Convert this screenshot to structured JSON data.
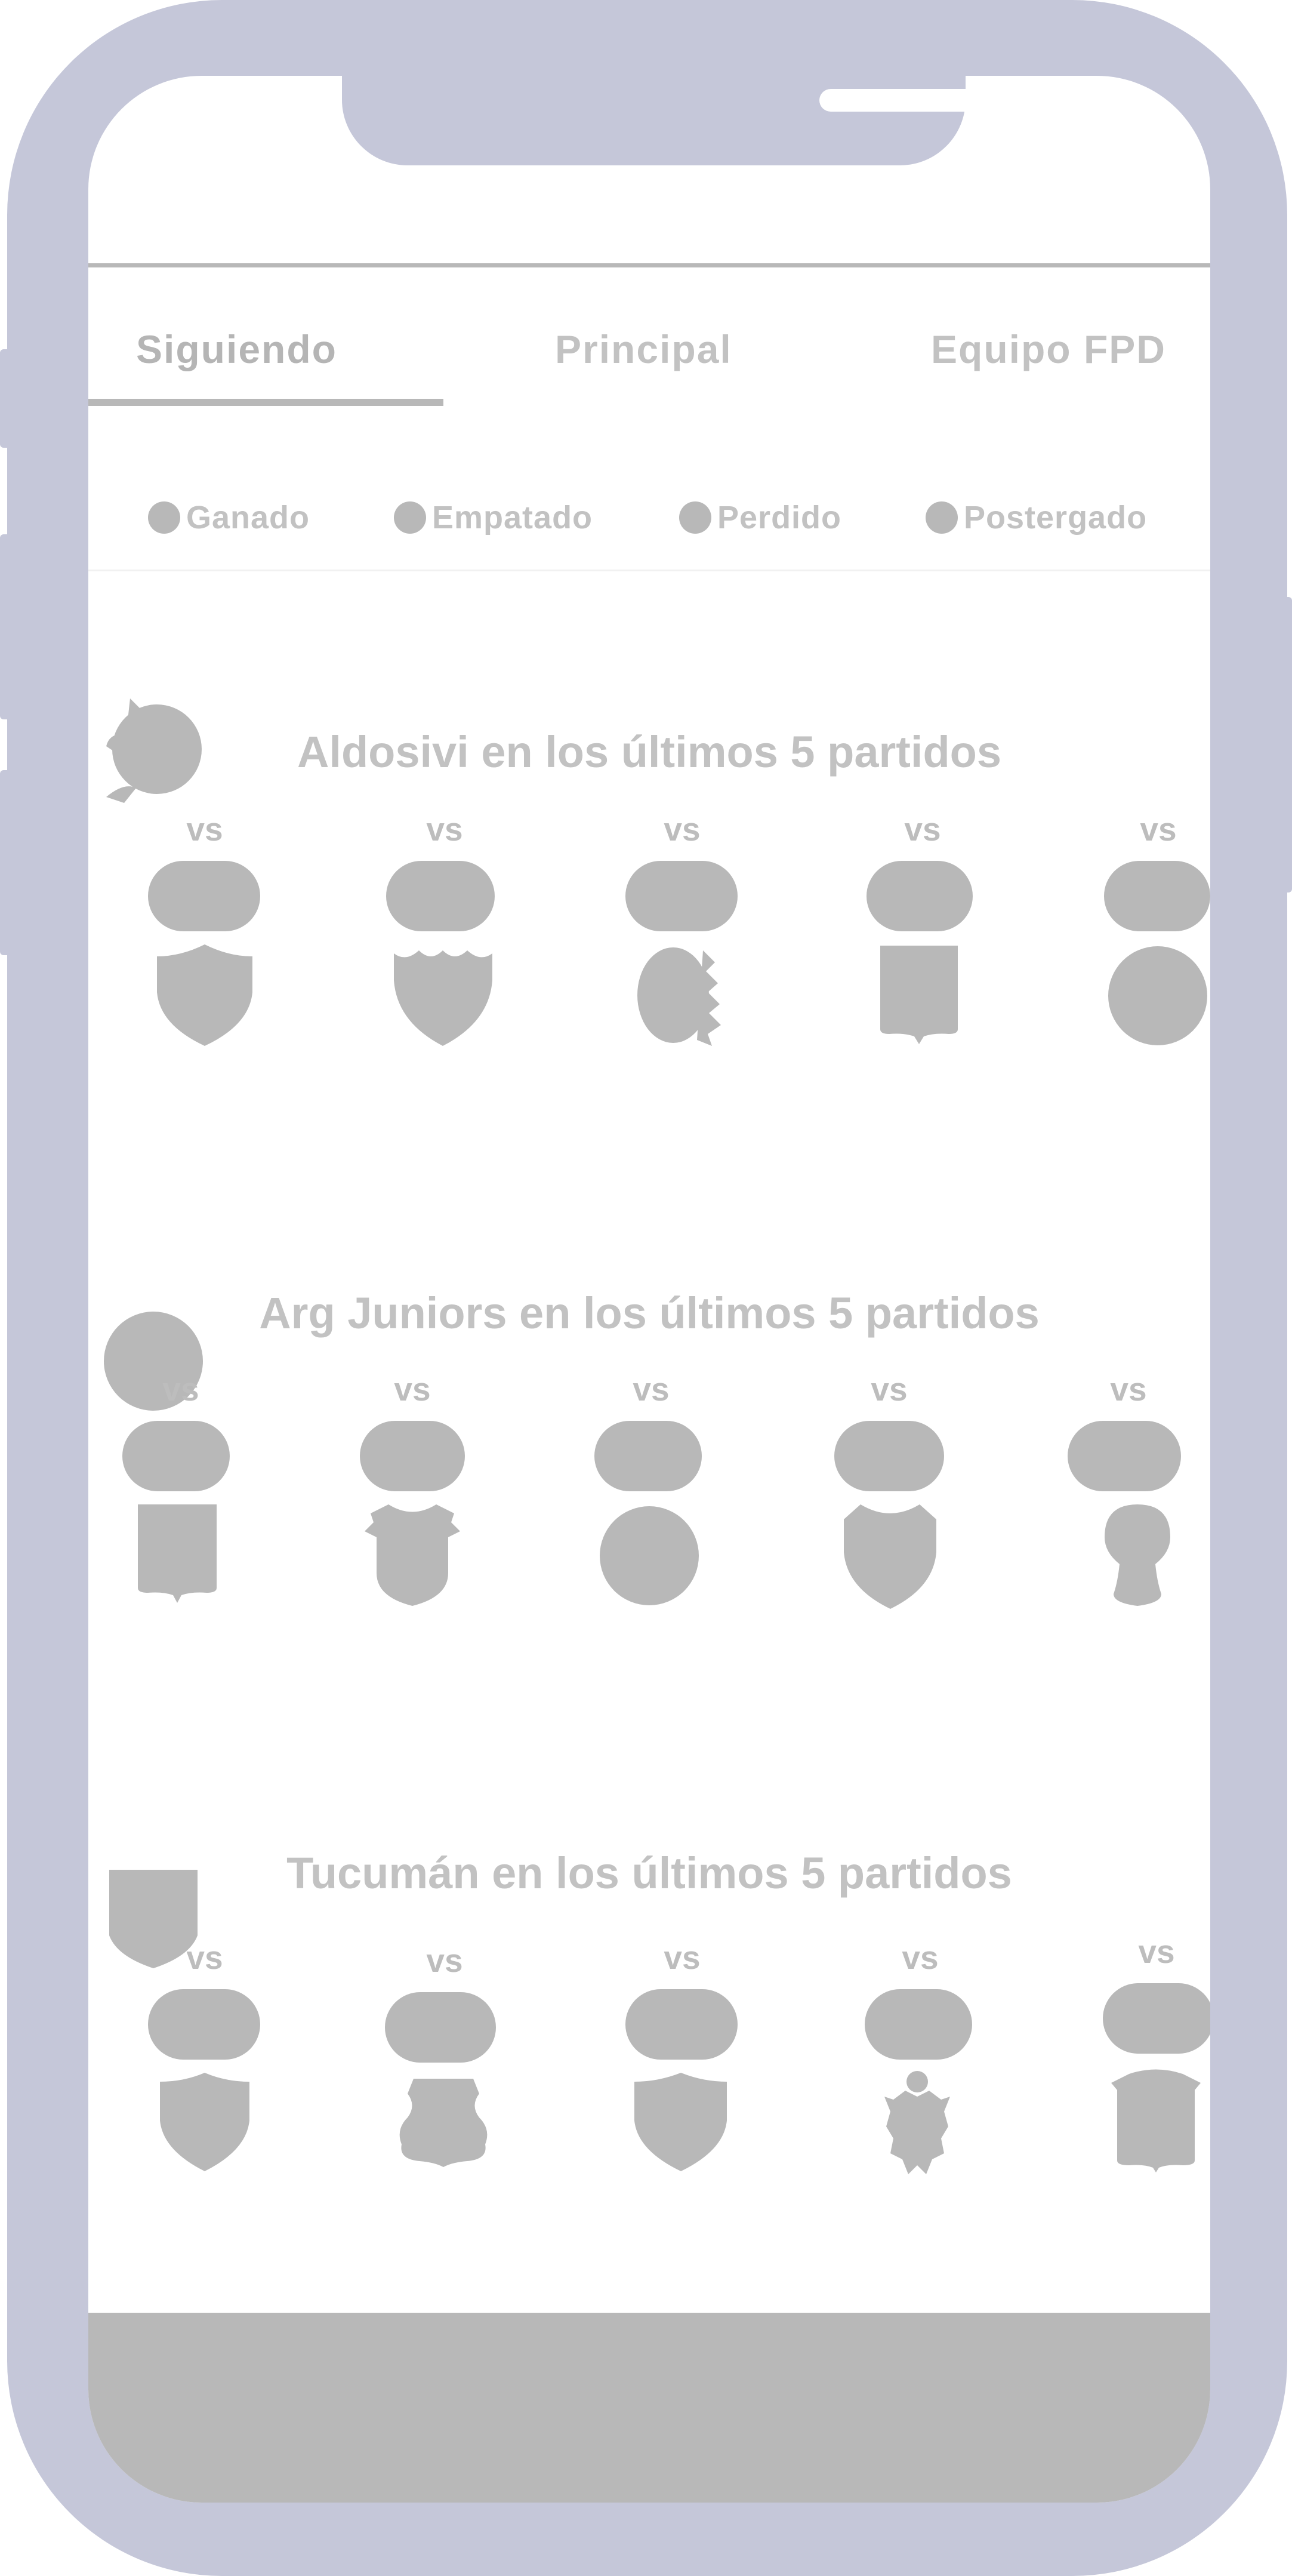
{
  "tabs": [
    {
      "label": "Siguiendo",
      "active": true
    },
    {
      "label": "Principal",
      "active": false
    },
    {
      "label": "Equipo FPD",
      "active": false
    }
  ],
  "legend": [
    {
      "label": "Ganado",
      "icon": "dot-icon"
    },
    {
      "label": "Empatado",
      "icon": "dot-icon"
    },
    {
      "label": "Perdido",
      "icon": "dot-icon"
    },
    {
      "label": "Postergado",
      "icon": "dot-icon"
    }
  ],
  "sections": [
    {
      "title": "Aldosivi en los últimos 5 partidos",
      "team_icon": "aldosivi-shark-icon",
      "matches": [
        {
          "vs": "vs",
          "crest_icon": "shield-notched-icon"
        },
        {
          "vs": "vs",
          "crest_icon": "shield-notched-icon"
        },
        {
          "vs": "vs",
          "crest_icon": "laurel-crest-icon"
        },
        {
          "vs": "vs",
          "crest_icon": "square-shield-icon"
        },
        {
          "vs": "vs",
          "crest_icon": "circle-crest-icon"
        }
      ]
    },
    {
      "title": "Arg Juniors en los últimos 5 partidos",
      "team_icon": "circle-crest-icon",
      "matches": [
        {
          "vs": "vs",
          "crest_icon": "square-shield-icon"
        },
        {
          "vs": "vs",
          "crest_icon": "crowned-crest-icon"
        },
        {
          "vs": "vs",
          "crest_icon": "circle-crest-icon"
        },
        {
          "vs": "vs",
          "crest_icon": "shield-notched-icon"
        },
        {
          "vs": "vs",
          "crest_icon": "bulb-crest-icon"
        }
      ]
    },
    {
      "title": "Tucumán en los últimos 5 partidos",
      "team_icon": "shield-icon",
      "matches": [
        {
          "vs": "vs",
          "crest_icon": "shield-notched-icon"
        },
        {
          "vs": "vs",
          "crest_icon": "badge-crest-icon"
        },
        {
          "vs": "vs",
          "crest_icon": "shield-notched-icon"
        },
        {
          "vs": "vs",
          "crest_icon": "eagle-crest-icon"
        },
        {
          "vs": "vs",
          "crest_icon": "flat-shield-icon"
        }
      ]
    }
  ],
  "colors": {
    "frame": "#c5c7d9",
    "placeholder": "#b8b8b8",
    "text": "#c2c2c2"
  }
}
